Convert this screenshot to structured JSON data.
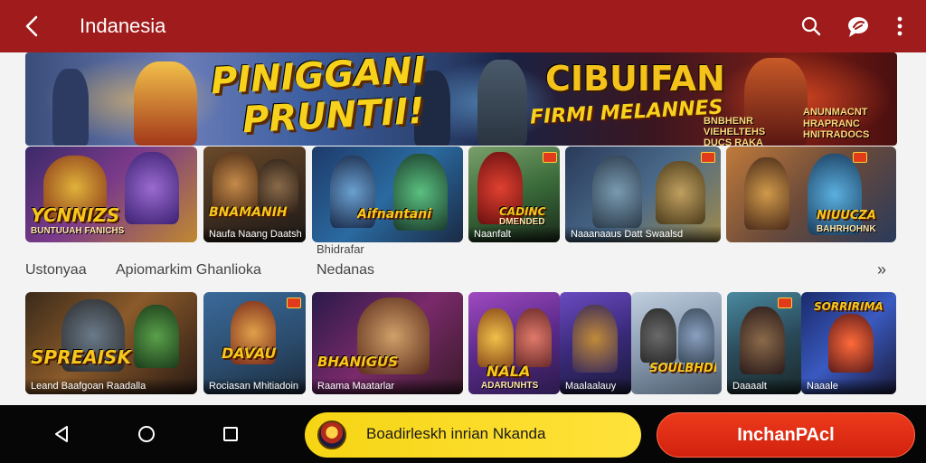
{
  "appbar": {
    "title": "Indanesia",
    "bg_color": "#a01b1b",
    "back_icon": "chevron-left-icon",
    "search_icon": "search-icon",
    "chat_icon": "chat-bubble-icon",
    "more_icon": "more-vertical-icon"
  },
  "hero": {
    "title_line1": "PINIGGANI",
    "title_line2": "PRUNTII!",
    "right_title": "CIBUIFAN",
    "right_subtitle": "FIRMI MELANNES",
    "small_left": "BNBHENR\nVIEHELTEHS\nDUCS RAKA",
    "small_right": "ANUNMACNT\nHRAPRANC\nHNITRADOCS"
  },
  "row1": [
    {
      "logo": "YCNNIZS",
      "sub": "BUNTUUAH FANICHS",
      "cap": ""
    },
    {
      "logo": "BNAMANIH",
      "sub": "",
      "cap": "Naufa Naang Daatsh"
    },
    {
      "logo": "Aifnantani",
      "sub": "",
      "cap": ""
    },
    {
      "logo": "CADINC",
      "sub": "DMENDED",
      "cap": "Naanfalt"
    },
    {
      "logo": "",
      "sub": "",
      "cap": "Naaanaaus Datt Swaalsd"
    },
    {
      "logo": "NIUUCZA",
      "sub": "BAHRHOHNK",
      "cap": ""
    }
  ],
  "labels": {
    "sec1": "Ustonyaa",
    "sec2": "Apiomarkim Ghanlioka",
    "sec3_top": "Bhidrafar",
    "sec3_bottom": "Nedanas",
    "more": "»"
  },
  "row2": [
    {
      "logo": "SPREAISK",
      "sub": "",
      "cap": "Leand Baafgoan Raadalla"
    },
    {
      "logo": "DAVAU",
      "sub": "",
      "cap": "Rociasan Mhitiadoin"
    },
    {
      "logo": "BHANIGUS",
      "sub": "",
      "cap": "Raama Maatarlar"
    },
    {
      "logo": "NALA",
      "sub": "ADARUNHTS",
      "cap": ""
    },
    {
      "logo": "",
      "sub": "",
      "cap": "Maalaalauy"
    },
    {
      "logo": "SOULBHDE",
      "sub": "",
      "cap": ""
    },
    {
      "logo": "",
      "sub": "",
      "cap": "Daaaalt"
    },
    {
      "logo": "SORRIRIMA",
      "sub": "",
      "cap": "Naaale"
    }
  ],
  "navbar": {
    "back_icon": "triangle-back-icon",
    "home_icon": "circle-home-icon",
    "recents_icon": "square-recents-icon"
  },
  "promo": {
    "text": "Boadirleskh inrian Nkanda",
    "color": "#f6d514"
  },
  "cta": {
    "label": "InchanPAcl",
    "color": "#e02c16"
  }
}
